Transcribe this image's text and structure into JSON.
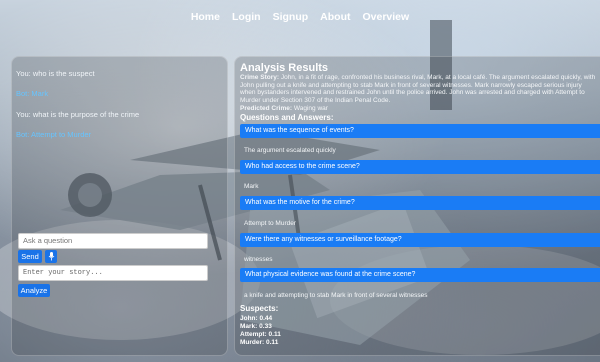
{
  "nav": {
    "items": [
      "Home",
      "Login",
      "Signup",
      "About",
      "Overview"
    ]
  },
  "chat": {
    "messages": [
      {
        "role": "user",
        "text": "You: who is the suspect"
      },
      {
        "role": "bot",
        "text": "Bot: Mark"
      },
      {
        "role": "user",
        "text": "You: what is the purpose of the crime"
      },
      {
        "role": "bot",
        "text": "Bot: Attempt to Murder"
      }
    ],
    "question_placeholder": "Ask a question",
    "send_label": "Send",
    "story_placeholder": "Enter your story...",
    "analyze_label": "Analyze"
  },
  "results": {
    "title": "Analysis Results",
    "story_label": "Crime Story:",
    "story_text": "John, in a fit of rage, confronted his business rival, Mark, at a local café. The argument escalated quickly, with John pulling out a knife and attempting to stab Mark in front of several witnesses. Mark narrowly escaped serious injury when bystanders intervened and restrained John until the police arrived. John was arrested and charged with Attempt to Murder under Section 307 of the Indian Penal Code.",
    "predicted_label": "Predicted Crime:",
    "predicted_value": "Waging war",
    "qa_heading": "Questions and Answers:",
    "qa": [
      {
        "q": "What was the sequence of events?",
        "a": "The argument escalated quickly"
      },
      {
        "q": "Who had access to the crime scene?",
        "a": "Mark"
      },
      {
        "q": "What was the motive for the crime?",
        "a": "Attempt to Murder"
      },
      {
        "q": "Were there any witnesses or surveillance footage?",
        "a": "witnesses"
      },
      {
        "q": "What physical evidence was found at the crime scene?",
        "a": "a knife and attempting to stab Mark in front of several witnesses"
      }
    ],
    "suspects_heading": "Suspects:",
    "suspects": [
      {
        "name": "John:",
        "score": "0.44"
      },
      {
        "name": "Mark:",
        "score": "0.33"
      },
      {
        "name": "Attempt:",
        "score": "0.11"
      },
      {
        "name": "Murder:",
        "score": "0.11"
      }
    ]
  }
}
